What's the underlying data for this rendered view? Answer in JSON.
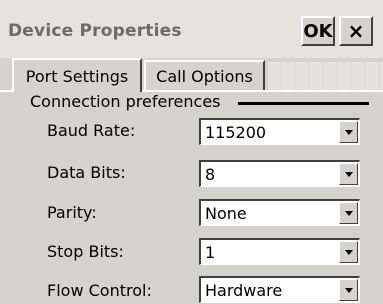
{
  "window": {
    "title": "Device Properties",
    "ok_label": "OK",
    "close_label": "×"
  },
  "tabs": [
    {
      "label": "Port Settings",
      "active": true
    },
    {
      "label": "Call Options",
      "active": false
    }
  ],
  "group": {
    "label": "Connection preferences"
  },
  "fields": [
    {
      "label": "Baud Rate:",
      "value": "115200"
    },
    {
      "label": "Data Bits:",
      "value": "8"
    },
    {
      "label": "Parity:",
      "value": "None"
    },
    {
      "label": "Stop Bits:",
      "value": "1"
    },
    {
      "label": "Flow Control:",
      "value": "Hardware"
    }
  ],
  "icons": {
    "dropdown": "chevron-down-icon"
  }
}
